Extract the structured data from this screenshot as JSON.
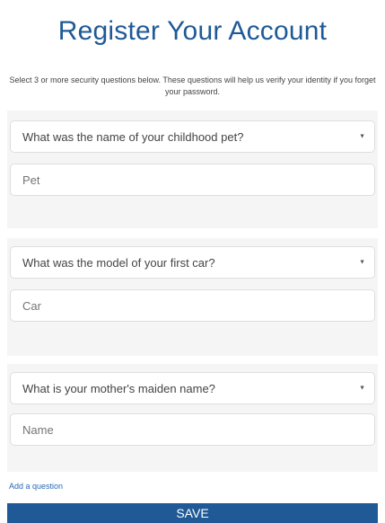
{
  "header": {
    "title": "Register Your Account",
    "intro": "Select 3 or more security questions below. These questions will help us verify your identity if you forget your password."
  },
  "questions": [
    {
      "question": "What was the name of your childhood pet?",
      "answer_placeholder": "Pet"
    },
    {
      "question": "What was the model of your first car?",
      "answer_placeholder": "Car"
    },
    {
      "question": "What is your mother's maiden name?",
      "answer_placeholder": "Name"
    }
  ],
  "dropdown_icon": "caret-down-icon",
  "add_question_label": "Add a question",
  "save_label": "SAVE",
  "colors": {
    "brand": "#1f5a96",
    "link": "#2a6ab3",
    "band": "#f5f5f5"
  }
}
